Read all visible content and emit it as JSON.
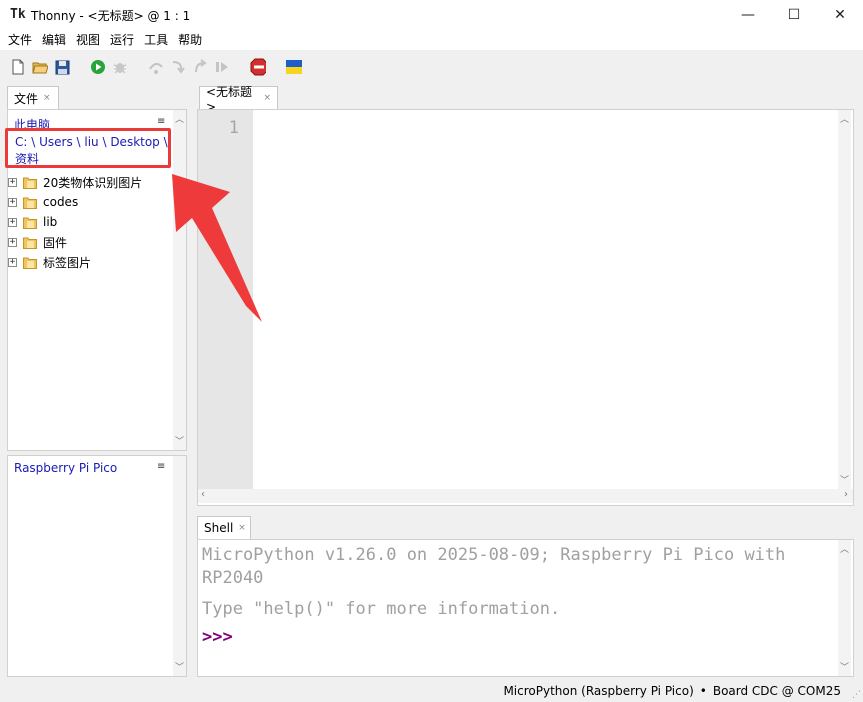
{
  "window": {
    "app_name": "Thonny",
    "title": "Thonny  -  <无标题>  @  1 : 1",
    "minimize_glyph": "—",
    "maximize_glyph": "☐",
    "close_glyph": "✕"
  },
  "menu": [
    "文件",
    "编辑",
    "视图",
    "运行",
    "工具",
    "帮助"
  ],
  "toolbar": {
    "icons": [
      "new-file-icon",
      "open-file-icon",
      "save-icon",
      "run-icon",
      "debug-icon",
      "step-over-icon",
      "step-into-icon",
      "step-out-icon",
      "resume-icon",
      "stop-icon",
      "ukraine-flag-icon"
    ]
  },
  "files_panel": {
    "tab_label": "文件",
    "section_title": "此电脑",
    "path": "C: \\ Users \\ liu \\ Desktop \\ 资料",
    "items": [
      "20类物体识别图片",
      "codes",
      "lib",
      "固件",
      "标签图片"
    ],
    "device_title": "Raspberry Pi Pico",
    "menu_glyph": "≡",
    "tab_close_glyph": "×"
  },
  "editor": {
    "tab_label": "<无标题>",
    "line_numbers": [
      "1"
    ]
  },
  "shell": {
    "tab_label": "Shell",
    "lines": [
      "MicroPython v1.26.0 on 2025-08-09; Raspberry Pi Pico with",
      "RP2040",
      "Type \"help()\" for more information."
    ],
    "prompt": ">>>"
  },
  "status": {
    "interpreter": "MicroPython (Raspberry Pi Pico)",
    "separator": "•",
    "port": "Board CDC @ COM25"
  },
  "colors": {
    "highlight_box": "#ea3a3a",
    "arrow": "#ee3a3a",
    "link_blue": "#1b1bb5",
    "prompt_purple": "#800080"
  }
}
